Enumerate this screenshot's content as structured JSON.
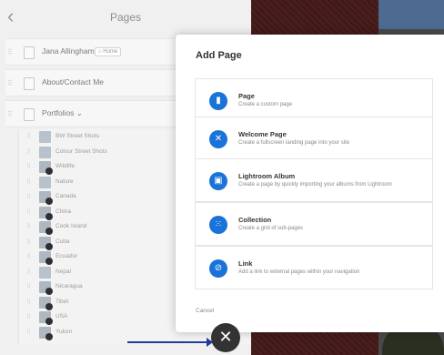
{
  "header": {
    "title": "Pages",
    "back_icon": "chevron-left-icon"
  },
  "pages": {
    "home_page": {
      "label": "Jana Allingham",
      "badge": "Home"
    },
    "about_page": {
      "label": "About/Contact Me"
    },
    "portfolios": {
      "label": "Portfolios"
    },
    "children": [
      {
        "label": "BW Street Shots",
        "type": "collection"
      },
      {
        "label": "Colour Street Shots",
        "type": "collection"
      },
      {
        "label": "Wildlife",
        "type": "album"
      },
      {
        "label": "Nature",
        "type": "collection"
      },
      {
        "label": "Canada",
        "type": "album"
      },
      {
        "label": "China",
        "type": "album"
      },
      {
        "label": "Cook Island",
        "type": "album"
      },
      {
        "label": "Cuba",
        "type": "album"
      },
      {
        "label": "Ecuador",
        "type": "album"
      },
      {
        "label": "Nepal",
        "type": "collection"
      },
      {
        "label": "Nicaragua",
        "type": "album"
      },
      {
        "label": "Tibet",
        "type": "album"
      },
      {
        "label": "USA",
        "type": "album"
      },
      {
        "label": "Yukon",
        "type": "album"
      }
    ]
  },
  "modal": {
    "title": "Add Page",
    "options": [
      {
        "title": "Page",
        "description": "Create a custom page",
        "icon": "page-icon"
      },
      {
        "title": "Welcome Page",
        "description": "Create a fullscreen landing page into your site",
        "icon": "welcome-icon"
      },
      {
        "title": "Lightroom Album",
        "description": "Create a page by quickly importing your albums from Lightroom",
        "icon": "lightroom-icon"
      },
      {
        "title": "Collection",
        "description": "Create a grid of sub-pages",
        "icon": "grid-icon"
      },
      {
        "title": "Link",
        "description": "Add a link to external pages within your navigation",
        "icon": "link-icon"
      }
    ],
    "cancel_label": "Cancel"
  },
  "colors": {
    "accent": "#1a73d9",
    "annotation_arrow": "#1f3a99"
  }
}
